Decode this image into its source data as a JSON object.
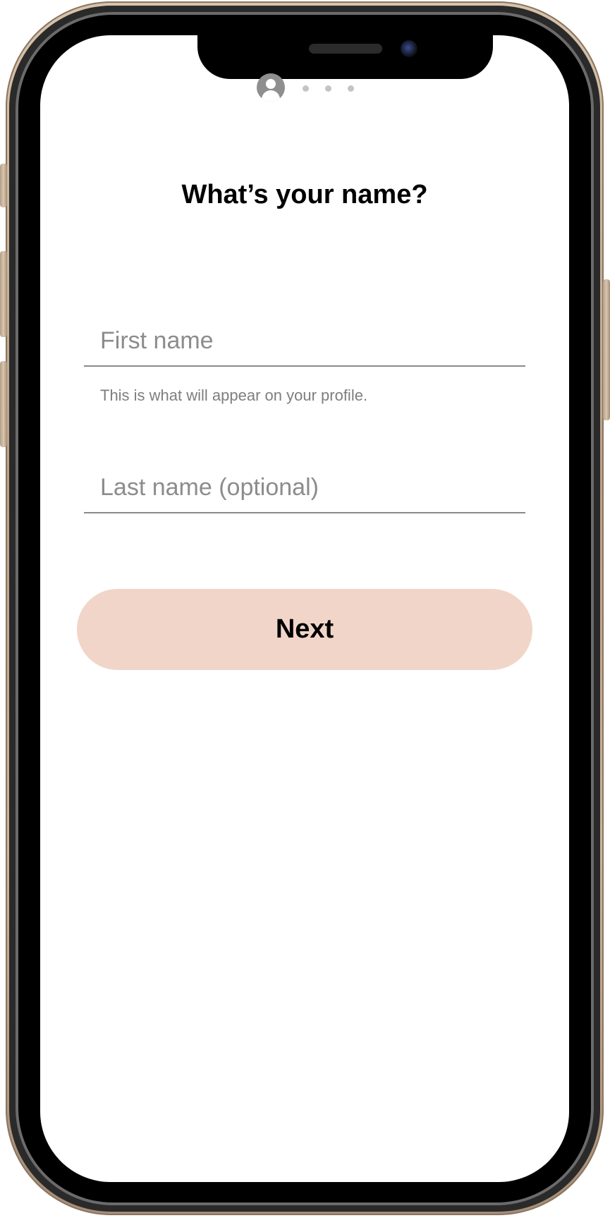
{
  "onboarding": {
    "progress": {
      "current_step": 1,
      "total_steps": 4,
      "current_step_icon": "user-avatar-icon"
    },
    "title": "What’s your name?",
    "first_name": {
      "placeholder": "First name",
      "value": "",
      "helper_text": "This is what will appear on your profile."
    },
    "last_name": {
      "placeholder": "Last name (optional)",
      "value": ""
    },
    "next_label": "Next"
  },
  "colors": {
    "next_button_bg": "#f2d5c9",
    "inactive_step_dot": "#c4c4c4",
    "active_step": "#8f8f8f",
    "input_underline": "#8a8a8a"
  }
}
